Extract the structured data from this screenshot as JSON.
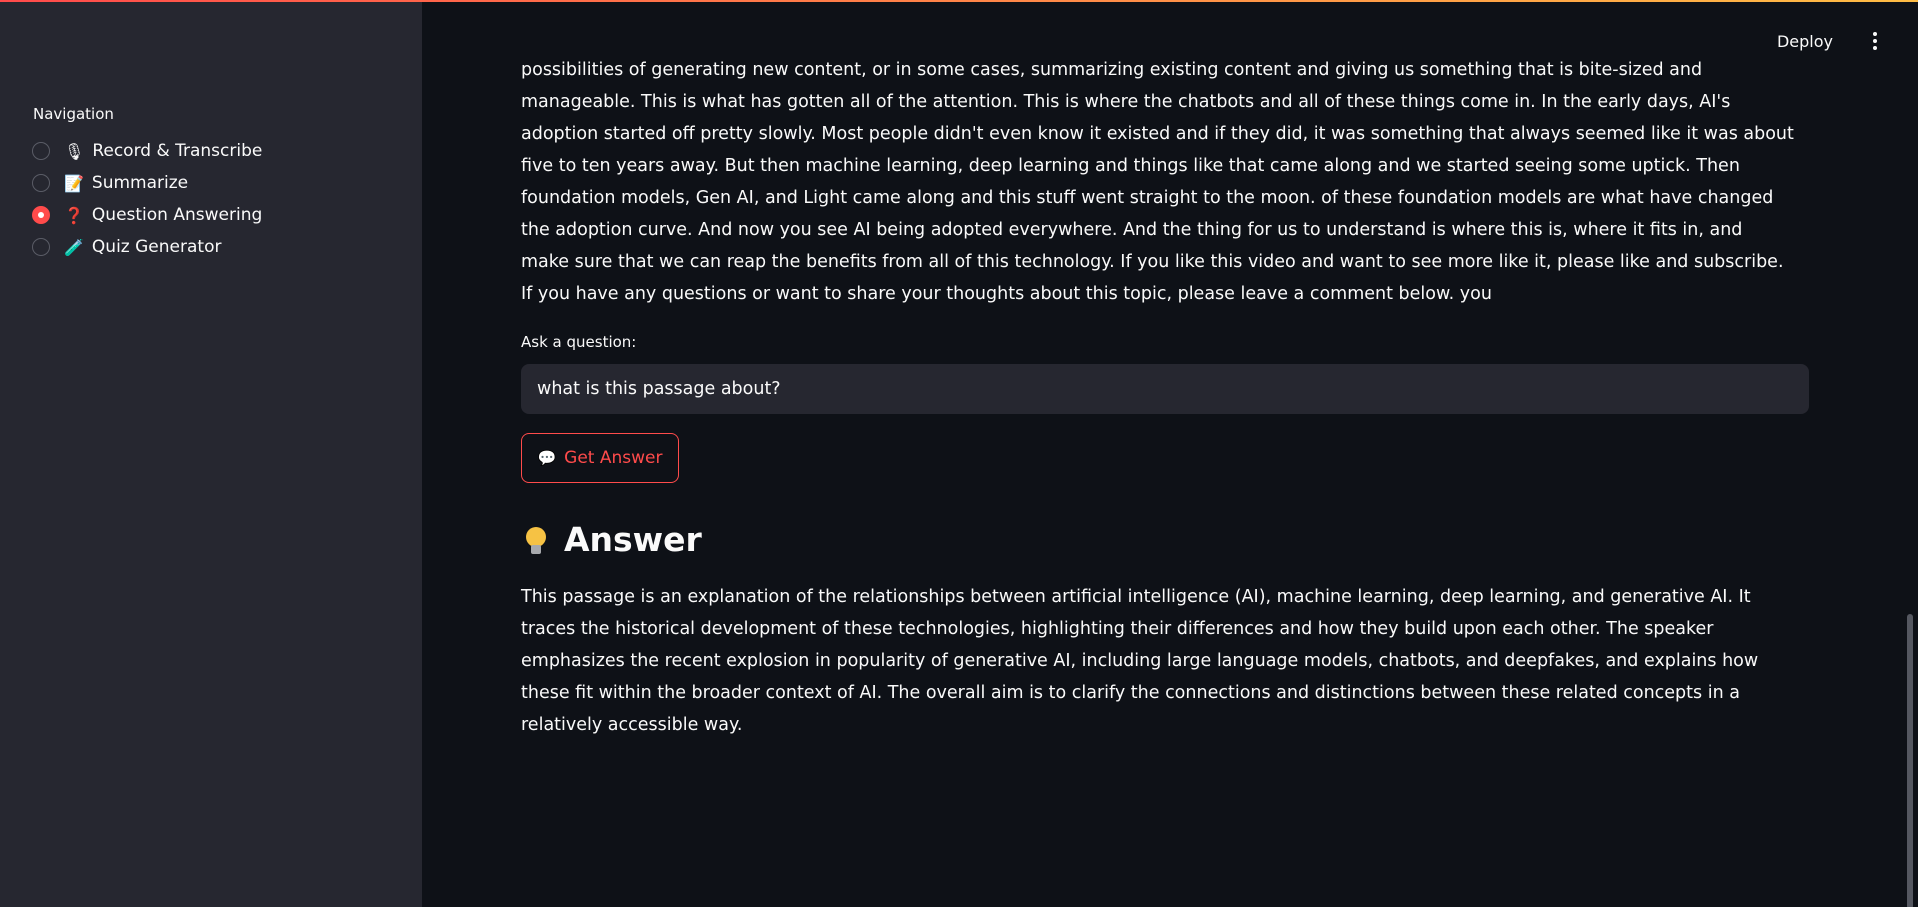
{
  "sidebar": {
    "nav_title": "Navigation",
    "items": [
      {
        "icon": "microphone-icon",
        "emoji": "🎙",
        "label": "Record & Transcribe",
        "selected": false
      },
      {
        "icon": "memo-icon",
        "emoji": "📝",
        "label": "Summarize",
        "selected": false
      },
      {
        "icon": "question-mark-icon",
        "emoji": "❓",
        "label": "Question Answering",
        "selected": true
      },
      {
        "icon": "test-tube-icon",
        "emoji": "🧪",
        "label": "Quiz Generator",
        "selected": false
      }
    ]
  },
  "header": {
    "deploy_label": "Deploy",
    "menu_icon": "kebab-menu-icon"
  },
  "main": {
    "transcript": "possibilities of generating new content, or in some cases, summarizing existing content and giving us something that is bite-sized and manageable. This is what has gotten all of the attention. This is where the chatbots and all of these things come in. In the early days, AI's adoption started off pretty slowly. Most people didn't even know it existed and if they did, it was something that always seemed like it was about five to ten years away. But then machine learning, deep learning and things like that came along and we started seeing some uptick. Then foundation models, Gen AI, and Light came along and this stuff went straight to the moon. of these foundation models are what have changed the adoption curve. And now you see AI being adopted everywhere. And the thing for us to understand is where this is, where it fits in, and make sure that we can reap the benefits from all of this technology. If you like this video and want to see more like it, please like and subscribe. If you have any questions or want to share your thoughts about this topic, please leave a comment below. you",
    "question_label": "Ask a question:",
    "question_value": "what is this passage about?",
    "button_icon": "💬",
    "button_label": "Get Answer",
    "answer_icon": "💡",
    "answer_heading": "Answer",
    "answer_text": "This passage is an explanation of the relationships between artificial intelligence (AI), machine learning, deep learning, and generative AI. It traces the historical development of these technologies, highlighting their differences and how they build upon each other. The speaker emphasizes the recent explosion in popularity of generative AI, including large language models, chatbots, and deepfakes, and explains how these fit within the broader context of AI. The overall aim is to clarify the connections and distinctions between these related concepts in a relatively accessible way."
  },
  "colors": {
    "accent": "#ff4b4b",
    "background": "#0e1117",
    "sidebar": "#262730"
  }
}
